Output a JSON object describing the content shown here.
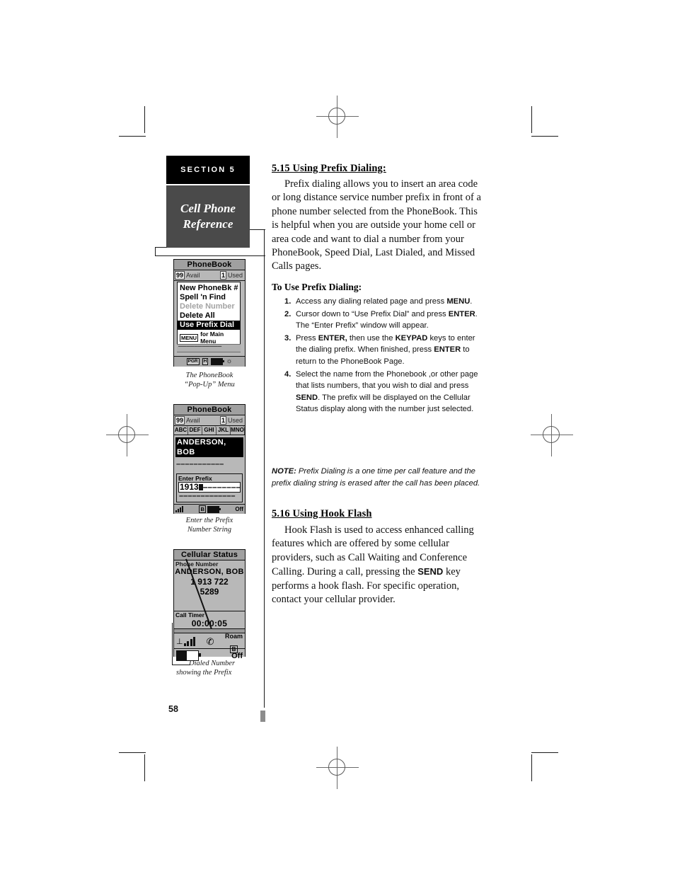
{
  "page": {
    "number": "58",
    "section_tab": {
      "label": "SECTION 5",
      "title_line1": "Cell Phone",
      "title_line2": "Reference"
    }
  },
  "right_column": {
    "heading_515": "5.15 Using Prefix Dialing:",
    "para_515": "Prefix dialing allows you to insert an area code or long distance service number prefix in front of a phone number selected from the PhoneBook. This is helpful when you are outside your home cell or area code and want to dial a number from your PhoneBook, Speed Dial, Last Dialed, and Missed Calls pages.",
    "subheading": "To Use Prefix Dialing:",
    "steps": [
      "Access any dialing related page and press MENU.",
      "Cursor down to “Use Prefix Dial” and press ENTER. The “Enter Prefix” window will appear.",
      "Press ENTER, then use the KEYPAD keys to enter the dialing prefix. When finished, press ENTER to return to the PhoneBook Page.",
      "Select the name from the Phonebook ,or other page that lists numbers, that you wish to dial and press SEND. The prefix will be displayed on the Cellular Status display along with the number just selected."
    ],
    "note_label": "NOTE:",
    "note_text": "Prefix Dialing is a one time per call feature and the prefix dialing string is erased after the call has been placed.",
    "heading_516": "5.16 Using Hook Flash",
    "para_516": "Hook Flash is used to access enhanced calling features which are offered by some cellular providers, such as Call Waiting and Conference Calling. During a call, pressing the SEND key performs a hook flash. For specific operation, contact your cellular provider."
  },
  "figures": [
    {
      "id": "phonebook-menu",
      "title": "PhoneBook",
      "avail_count": "99",
      "avail_label": "Avail",
      "used_count": "1",
      "used_label": "Used",
      "menu_items": [
        {
          "label": "New PhoneBk #",
          "state": "normal"
        },
        {
          "label": "Spell 'n Find",
          "state": "normal"
        },
        {
          "label": "Delete Number",
          "state": "disabled"
        },
        {
          "label": "Delete All",
          "state": "normal"
        },
        {
          "label": "Use Prefix Dial",
          "state": "selected"
        }
      ],
      "footer_key": "MENU",
      "footer_text": "for Main Menu",
      "caption_line1": "The PhoneBook",
      "caption_line2": "“Pop-Up” Menu"
    },
    {
      "id": "enter-prefix",
      "title": "PhoneBook",
      "avail_count": "99",
      "avail_label": "Avail",
      "used_count": "1",
      "used_label": "Used",
      "alpha_tabs": [
        "ABC",
        "DEF",
        "GHI",
        "JKL",
        "MNO"
      ],
      "selected_entry": "ANDERSON, BOB",
      "blank_entry": "–––––––––––",
      "prefix_window_label": "Enter Prefix",
      "prefix_value": "1913",
      "prefix_rest": "–––––––––",
      "prefix_second_line": "–––––––––––––",
      "status_off": "Off",
      "status_roam": "B",
      "caption_line1": "Enter the Prefix",
      "caption_line2": "Number String"
    },
    {
      "id": "cellular-status",
      "title": "Cellular Status",
      "phone_number_label": "Phone Number",
      "name": "ANDERSON, BOB",
      "number_line1": "1 913 722",
      "number_line2": "5289",
      "call_timer_label": "Call Timer",
      "call_timer_value": "00:00:05",
      "roam_label": "Roam",
      "roam_band": "B",
      "power_state": "Off",
      "caption_line1": "Dialed Number",
      "caption_line2": "showing the Prefix"
    }
  ],
  "colors": {
    "tab_black": "#000000",
    "tab_gray": "#4a4a4a",
    "lcd_background": "#b8b8b8",
    "lcd_ink": "#111111"
  }
}
